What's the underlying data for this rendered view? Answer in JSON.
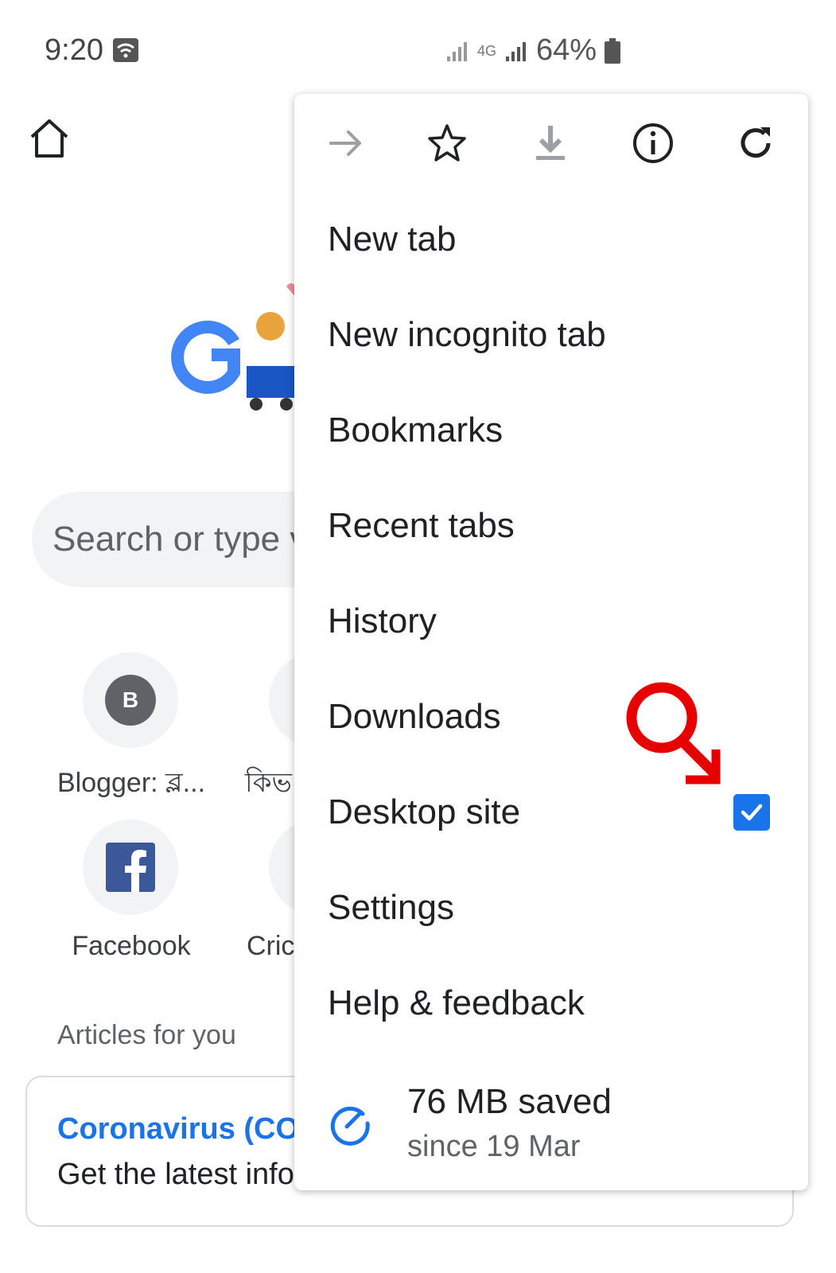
{
  "status_bar": {
    "time": "9:20",
    "network": "4G",
    "battery": "64%",
    "icons": [
      "wifi-icon",
      "signal-icon",
      "battery-icon"
    ]
  },
  "page": {
    "search_placeholder": "Search or type v",
    "shortcuts": [
      {
        "label": "Blogger: ব্ল...",
        "avatar_letter": "B"
      },
      {
        "label": "কিভ"
      },
      {
        "label": "Facebook"
      },
      {
        "label": "Cric"
      }
    ],
    "articles_label": "Articles for you",
    "article": {
      "title": "Coronavirus (COV",
      "subtitle": "Get the latest info"
    }
  },
  "menu": {
    "toolbar_icons": [
      "forward-icon",
      "star-icon",
      "download-icon",
      "info-icon",
      "refresh-icon"
    ],
    "items": [
      {
        "label": "New tab"
      },
      {
        "label": "New incognito tab"
      },
      {
        "label": "Bookmarks"
      },
      {
        "label": "Recent tabs"
      },
      {
        "label": "History"
      },
      {
        "label": "Downloads"
      },
      {
        "label": "Desktop site",
        "checked": true
      },
      {
        "label": "Settings"
      },
      {
        "label": "Help & feedback"
      }
    ],
    "data_saver": {
      "title": "76 MB saved",
      "subtitle": "since 19 Mar"
    }
  },
  "colors": {
    "accent": "#1a73e8",
    "annotation": "#e60000"
  }
}
